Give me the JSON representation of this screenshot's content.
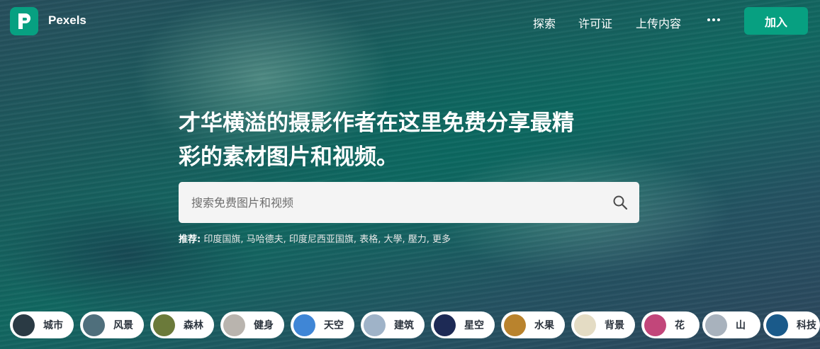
{
  "nav": {
    "brand": "Pexels",
    "links": [
      "探索",
      "许可证",
      "上传内容"
    ],
    "join_label": "加入"
  },
  "hero": {
    "headline_line1": "才华横溢的摄影作者在这里免费分享最精",
    "headline_line2": "彩的素材图片和视频。"
  },
  "search": {
    "placeholder": "搜索免费图片和视频"
  },
  "suggestions": {
    "label": "推荐:",
    "items": [
      "印度国旗",
      "马哈德夫",
      "印度尼西亚国旗",
      "表格",
      "大學",
      "壓力",
      "更多"
    ]
  },
  "categories": [
    {
      "label": "城市",
      "thumb_color": "#2a3a44"
    },
    {
      "label": "风景",
      "thumb_color": "#4f6f7c"
    },
    {
      "label": "森林",
      "thumb_color": "#6b7a3a"
    },
    {
      "label": "健身",
      "thumb_color": "#b9b4ae"
    },
    {
      "label": "天空",
      "thumb_color": "#3f86d6"
    },
    {
      "label": "建筑",
      "thumb_color": "#9fb3c8"
    },
    {
      "label": "星空",
      "thumb_color": "#1d2a55"
    },
    {
      "label": "水果",
      "thumb_color": "#b9832d"
    },
    {
      "label": "背景",
      "thumb_color": "#e4dcc4"
    },
    {
      "label": "花",
      "thumb_color": "#c2467a"
    },
    {
      "label": "山",
      "thumb_color": "#a8b2bd"
    },
    {
      "label": "科技",
      "thumb_color": "#1a5a8a"
    }
  ],
  "colors": {
    "brand": "#07a081"
  }
}
